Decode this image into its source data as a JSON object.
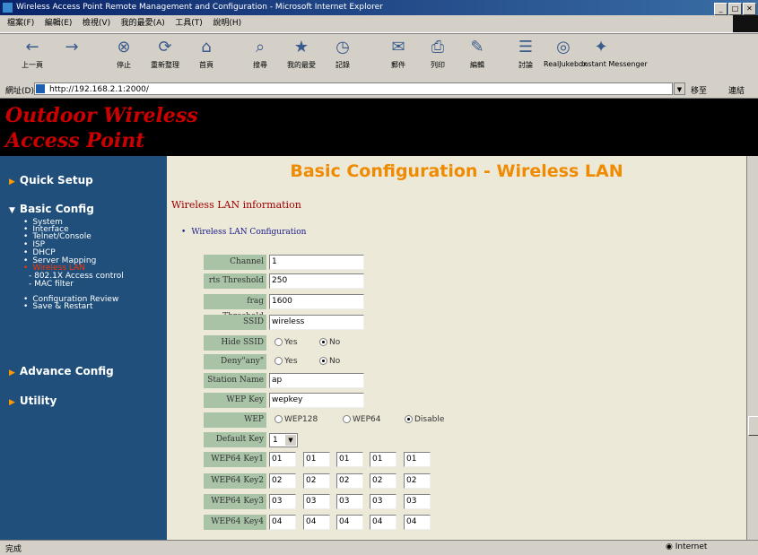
{
  "window": {
    "title": "Wireless Access Point Remote Management and Configuration - Microsoft Internet Explorer",
    "controls": [
      "_",
      "□",
      "✕"
    ]
  },
  "menu": [
    "檔案(F)",
    "編輯(E)",
    "檢視(V)",
    "我的最愛(A)",
    "工具(T)",
    "說明(H)"
  ],
  "toolbar": [
    {
      "label": "上一頁",
      "icon": "back-icon",
      "glyph": "←"
    },
    {
      "label": "",
      "icon": "forward-icon",
      "glyph": "→"
    },
    {
      "label": "停止",
      "icon": "stop-icon",
      "glyph": "⊗"
    },
    {
      "label": "重新整理",
      "icon": "refresh-icon",
      "glyph": "⟳"
    },
    {
      "label": "首頁",
      "icon": "home-icon",
      "glyph": "⌂"
    },
    {
      "label": "搜尋",
      "icon": "search-icon",
      "glyph": "⌕"
    },
    {
      "label": "我的最愛",
      "icon": "favorites-icon",
      "glyph": "★"
    },
    {
      "label": "記錄",
      "icon": "history-icon",
      "glyph": "◷"
    },
    {
      "label": "郵件",
      "icon": "mail-icon",
      "glyph": "✉"
    },
    {
      "label": "列印",
      "icon": "print-icon",
      "glyph": "⎙"
    },
    {
      "label": "編輯",
      "icon": "edit-icon",
      "glyph": "✎"
    },
    {
      "label": "討論",
      "icon": "discuss-icon",
      "glyph": "☰"
    },
    {
      "label": "RealJukebox",
      "icon": "realjukebox-icon",
      "glyph": "◎"
    },
    {
      "label": "Instant Messenger",
      "icon": "messenger-icon",
      "glyph": "✦"
    }
  ],
  "address": {
    "label": "網址(D)",
    "url": "http://192.168.2.1:2000/",
    "go": "移至",
    "links": "連結"
  },
  "banner": {
    "line1": "Outdoor Wireless",
    "line2": "Access Point"
  },
  "sidebar": {
    "quick_setup": "Quick Setup",
    "basic_config": "Basic Config",
    "basic_items": [
      "System",
      "Interface",
      "Telnet/Console",
      "ISP",
      "DHCP",
      "Server Mapping",
      "Wireless LAN"
    ],
    "wlan_sub": [
      "- 802.1X Access control",
      "- MAC filter"
    ],
    "basic_items2": [
      "Configuration Review",
      "Save & Restart"
    ],
    "advance_config": "Advance Config",
    "utility": "Utility"
  },
  "main": {
    "heading": "Basic Configuration - Wireless LAN",
    "section": "Wireless LAN information",
    "subsection": "Wireless LAN Configuration",
    "fields": {
      "channel": {
        "label": "Channel",
        "value": "1"
      },
      "rts": {
        "label": "rts Threshold",
        "value": "250"
      },
      "frag": {
        "label": "frag Threshold",
        "value": "1600"
      },
      "ssid": {
        "label": "SSID",
        "value": "wireless"
      },
      "hide_ssid": {
        "label": "Hide SSID",
        "opt1": "Yes",
        "opt2": "No"
      },
      "deny_any": {
        "label": "Deny\"any\"",
        "opt1": "Yes",
        "opt2": "No"
      },
      "station": {
        "label": "Station Name",
        "value": "ap"
      },
      "wep_key": {
        "label": "WEP Key",
        "value": "wepkey"
      },
      "wep": {
        "label": "WEP",
        "opt1": "WEP128",
        "opt2": "WEP64",
        "opt3": "Disable"
      },
      "default_key": {
        "label": "Default Key",
        "value": "1"
      }
    },
    "wep64": [
      {
        "label": "WEP64 Key1",
        "values": [
          "01",
          "01",
          "01",
          "01",
          "01"
        ]
      },
      {
        "label": "WEP64 Key2",
        "values": [
          "02",
          "02",
          "02",
          "02",
          "02"
        ]
      },
      {
        "label": "WEP64 Key3",
        "values": [
          "03",
          "03",
          "03",
          "03",
          "03"
        ]
      },
      {
        "label": "WEP64 Key4",
        "values": [
          "04",
          "04",
          "04",
          "04",
          "04"
        ]
      }
    ]
  },
  "status": {
    "left": "完成",
    "zone": "Internet"
  }
}
